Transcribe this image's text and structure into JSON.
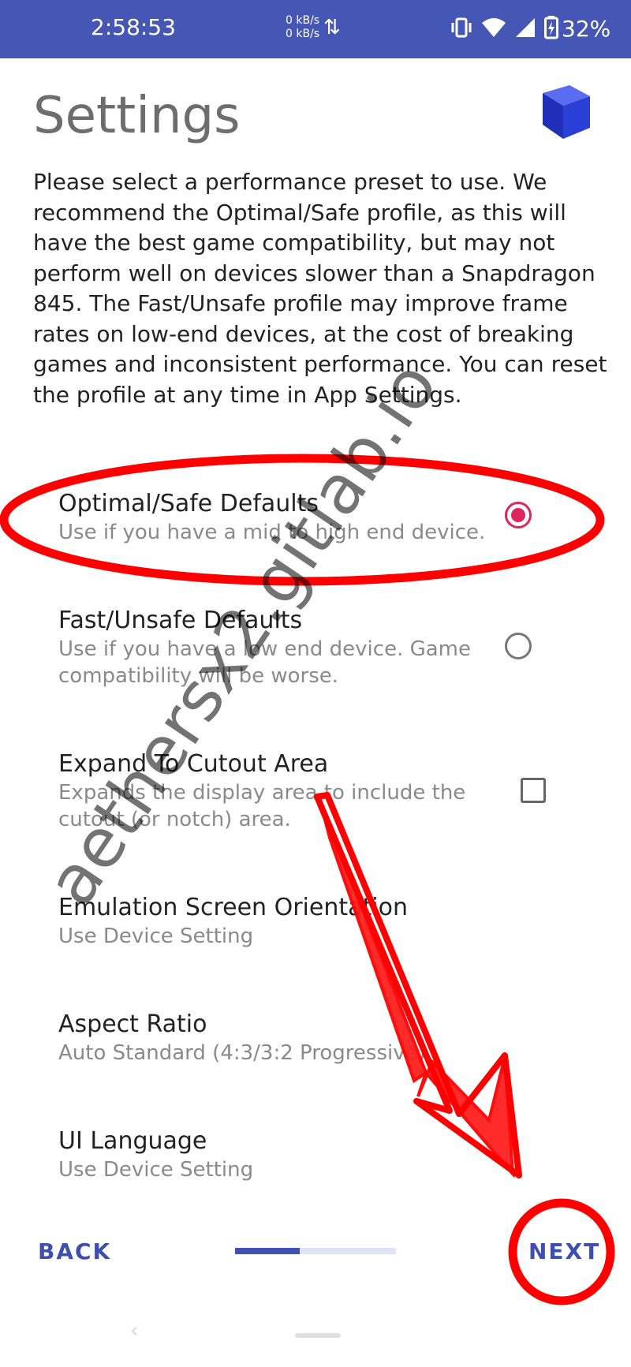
{
  "status_bar": {
    "time": "2:58:53",
    "speed_up": "0 kB/s",
    "speed_down": "0 kB/s",
    "battery": "32%",
    "icons": [
      "data-transfer-icon",
      "vibrate-icon",
      "wifi-icon",
      "signal-icon",
      "battery-icon"
    ]
  },
  "header": {
    "title": "Settings",
    "logo_icon": "cube-icon",
    "logo_color": "#2a3fd6"
  },
  "description": "Please select a performance preset to use. We recommend the Optimal/Safe profile, as this will have the best game compatibility, but may not perform well on devices slower than a Snapdragon 845. The Fast/Unsafe profile may improve frame rates on low-end devices, at the cost of breaking games and inconsistent performance. You can reset the profile at any time in App Settings.",
  "options": [
    {
      "title": "Optimal/Safe Defaults",
      "subtitle": "Use if you have a mid to high end device.",
      "control": "radio",
      "checked": true
    },
    {
      "title": "Fast/Unsafe Defaults",
      "subtitle": "Use if you have a low end device. Game compatibility will be worse.",
      "control": "radio",
      "checked": false
    },
    {
      "title": "Expand To Cutout Area",
      "subtitle": "Expands the display area to include the cutout (or notch) area.",
      "control": "checkbox",
      "checked": false
    },
    {
      "title": "Emulation Screen Orientation",
      "subtitle": "Use Device Setting"
    },
    {
      "title": "Aspect Ratio",
      "subtitle": "Auto Standard (4:3/3:2 Progressive)"
    },
    {
      "title": "UI Language",
      "subtitle": "Use Device Setting"
    }
  ],
  "footer": {
    "back_label": "BACK",
    "next_label": "NEXT",
    "progress": 0.4
  },
  "watermark": "aethersx2.gitlab.io",
  "colors": {
    "status_bar": "#4656b4",
    "accent": "#3f4fb0",
    "radio_checked": "#e0245e",
    "annotation": "#ff0000"
  }
}
